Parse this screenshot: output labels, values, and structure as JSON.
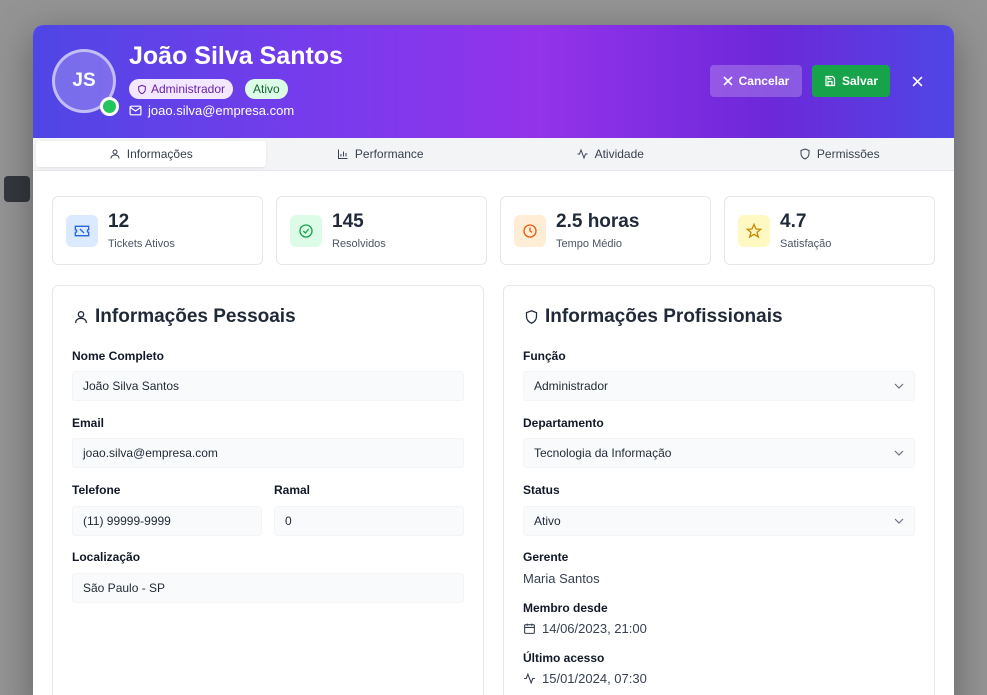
{
  "user": {
    "initials": "JS",
    "name": "João Silva Santos",
    "role_badge": "Administrador",
    "status_badge": "Ativo",
    "email": "joao.silva@empresa.com"
  },
  "actions": {
    "cancel_label": "Cancelar",
    "save_label": "Salvar"
  },
  "tabs": [
    {
      "label": "Informações",
      "icon": "user-icon",
      "active": true
    },
    {
      "label": "Performance",
      "icon": "bar-chart-icon",
      "active": false
    },
    {
      "label": "Atividade",
      "icon": "activity-icon",
      "active": false
    },
    {
      "label": "Permissões",
      "icon": "shield-icon",
      "active": false
    }
  ],
  "stats": [
    {
      "value": "12",
      "label": "Tickets Ativos",
      "icon": "ticket-icon",
      "color": "#2563eb",
      "bg": "#dbeafe"
    },
    {
      "value": "145",
      "label": "Resolvidos",
      "icon": "check-circle-icon",
      "color": "#16a34a",
      "bg": "#dcfce7"
    },
    {
      "value": "2.5 horas",
      "label": "Tempo Médio",
      "icon": "clock-icon",
      "color": "#ea580c",
      "bg": "#ffedd5"
    },
    {
      "value": "4.7",
      "label": "Satisfação",
      "icon": "star-icon",
      "color": "#ca8a04",
      "bg": "#fef9c3"
    }
  ],
  "personal": {
    "title": "Informações Pessoais",
    "full_name_label": "Nome Completo",
    "full_name_value": "João Silva Santos",
    "email_label": "Email",
    "email_value": "joao.silva@empresa.com",
    "phone_label": "Telefone",
    "phone_value": "(11) 99999-9999",
    "ext_label": "Ramal",
    "ext_value": "0",
    "location_label": "Localização",
    "location_value": "São Paulo - SP"
  },
  "professional": {
    "title": "Informações Profissionais",
    "role_label": "Função",
    "role_value": "Administrador",
    "dept_label": "Departamento",
    "dept_value": "Tecnologia da Informação",
    "status_label": "Status",
    "status_value": "Ativo",
    "manager_label": "Gerente",
    "manager_value": "Maria Santos",
    "member_since_label": "Membro desde",
    "member_since_value": "14/06/2023, 21:00",
    "last_access_label": "Último acesso",
    "last_access_value": "15/01/2024, 07:30"
  },
  "colors": {
    "header_gradient_start": "#4f46e5",
    "header_gradient_mid": "#9333ea",
    "online": "#22c55e",
    "save": "#16a34a"
  }
}
